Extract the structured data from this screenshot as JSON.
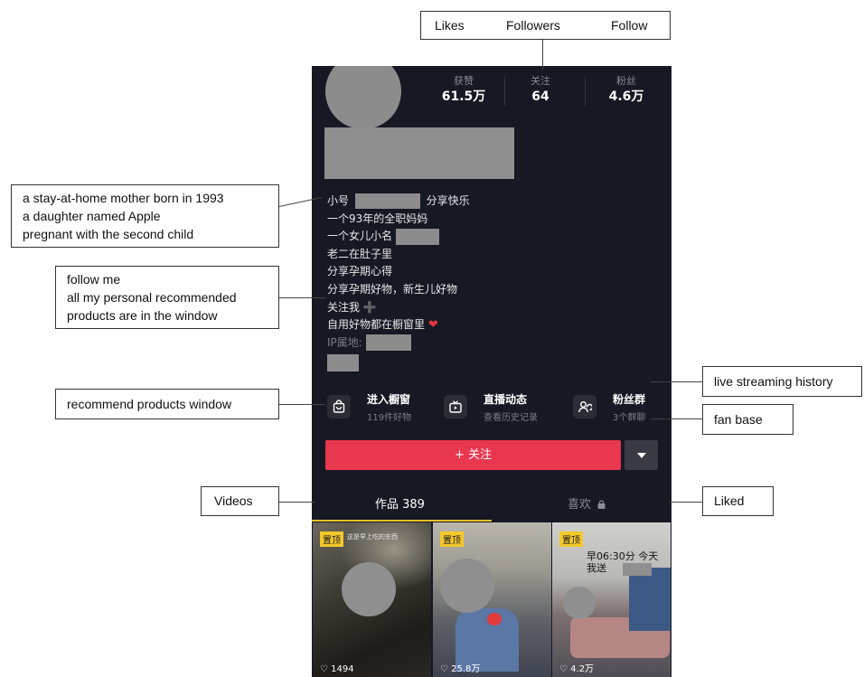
{
  "profile": {
    "stats": {
      "likes": {
        "label": "获赞",
        "value": "61.5万"
      },
      "following": {
        "label": "关注",
        "value": "64"
      },
      "fans": {
        "label": "粉丝",
        "value": "4.6万"
      }
    },
    "bio": {
      "line1_pre": "小号",
      "line1_post": "分享快乐",
      "line2": "一个93年的全职妈妈",
      "line3": "一个女儿小名",
      "line4": "老二在肚子里",
      "line5": "分享孕期心得",
      "line6": "分享孕期好物，新生儿好物",
      "line7": "关注我",
      "line8": "自用好物都在橱窗里",
      "ip_label": "IP属地:"
    },
    "shortcuts": [
      {
        "title": "进入橱窗",
        "sub": "119件好物",
        "icon": "shopping-bag-icon"
      },
      {
        "title": "直播动态",
        "sub": "查看历史记录",
        "icon": "tv-icon"
      },
      {
        "title": "粉丝群",
        "sub": "3个群聊",
        "icon": "group-icon"
      }
    ],
    "follow_button": "+ 关注",
    "tabs": {
      "works": "作品 389",
      "liked": "喜欢"
    },
    "videos": [
      {
        "pin": "置顶",
        "likes": "1494",
        "caption": "这是早上吃的东西"
      },
      {
        "pin": "置顶",
        "likes": "25.8万"
      },
      {
        "pin": "置顶",
        "likes": "4.2万",
        "caption": "早06:30分 今天我送"
      }
    ]
  },
  "annotations": {
    "header_likes": "Likes",
    "header_followers": "Followers",
    "header_follow": "Follow",
    "bio_line1": "a stay-at-home mother born in 1993",
    "bio_line2": "a daughter named Apple",
    "bio_line3": "pregnant with the second child",
    "follow_line1": "follow me",
    "follow_line2": "all my personal recommended",
    "follow_line3": "products are in the window",
    "window": "recommend products window",
    "live": "live streaming history",
    "fanbase": "fan base",
    "videos": "Videos",
    "liked": "Liked"
  },
  "colors": {
    "background": "#161823",
    "accent": "#e8374f",
    "pin": "#f4c82b",
    "heart": "#e2353f"
  }
}
